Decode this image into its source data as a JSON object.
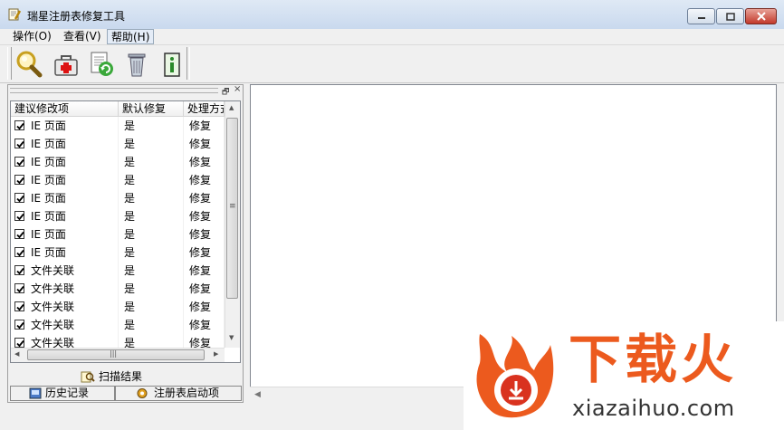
{
  "window": {
    "title": "瑞星注册表修复工具",
    "icon": "app-wrench-icon",
    "controls": {
      "minimize": "minimize-icon",
      "maximize": "maximize-icon",
      "close": "close-icon"
    }
  },
  "menu": {
    "items": [
      "操作(O)",
      "查看(V)",
      "帮助(H)"
    ],
    "highlighted": "帮助(H)"
  },
  "toolbar": {
    "buttons": [
      {
        "name": "scan-button",
        "icon": "magnifier-icon"
      },
      {
        "name": "repair-button",
        "icon": "medical-kit-icon"
      },
      {
        "name": "restore-button",
        "icon": "document-refresh-icon"
      },
      {
        "name": "delete-button",
        "icon": "trash-icon"
      },
      {
        "name": "info-button",
        "icon": "info-icon"
      }
    ]
  },
  "left_pane": {
    "float_glyph": "🗗",
    "close_glyph": "×",
    "columns": [
      "建议修改项",
      "默认修复",
      "处理方式"
    ],
    "rows": [
      {
        "checked": true,
        "item": "IE 页面",
        "default": "是",
        "action": "修复"
      },
      {
        "checked": true,
        "item": "IE 页面",
        "default": "是",
        "action": "修复"
      },
      {
        "checked": true,
        "item": "IE 页面",
        "default": "是",
        "action": "修复"
      },
      {
        "checked": true,
        "item": "IE 页面",
        "default": "是",
        "action": "修复"
      },
      {
        "checked": true,
        "item": "IE 页面",
        "default": "是",
        "action": "修复"
      },
      {
        "checked": true,
        "item": "IE 页面",
        "default": "是",
        "action": "修复"
      },
      {
        "checked": true,
        "item": "IE 页面",
        "default": "是",
        "action": "修复"
      },
      {
        "checked": true,
        "item": "IE 页面",
        "default": "是",
        "action": "修复"
      },
      {
        "checked": true,
        "item": "文件关联",
        "default": "是",
        "action": "修复"
      },
      {
        "checked": true,
        "item": "文件关联",
        "default": "是",
        "action": "修复"
      },
      {
        "checked": true,
        "item": "文件关联",
        "default": "是",
        "action": "修复"
      },
      {
        "checked": true,
        "item": "文件关联",
        "default": "是",
        "action": "修复"
      },
      {
        "checked": true,
        "item": "文件关联",
        "default": "是",
        "action": "修复"
      }
    ],
    "scan_results_tab": "扫描结果",
    "tabs": [
      "历史记录",
      "注册表启动项"
    ]
  },
  "scroll_glyphs": {
    "up": "▲",
    "down": "▼",
    "left": "◀",
    "right": "▶",
    "grip_v": "≡",
    "grip_h": "|||"
  },
  "watermark": {
    "brand_cn": "下载火",
    "url": "xiazaihuo.com",
    "colors": {
      "orange": "#ec5a1e",
      "red": "#d9321f"
    }
  }
}
